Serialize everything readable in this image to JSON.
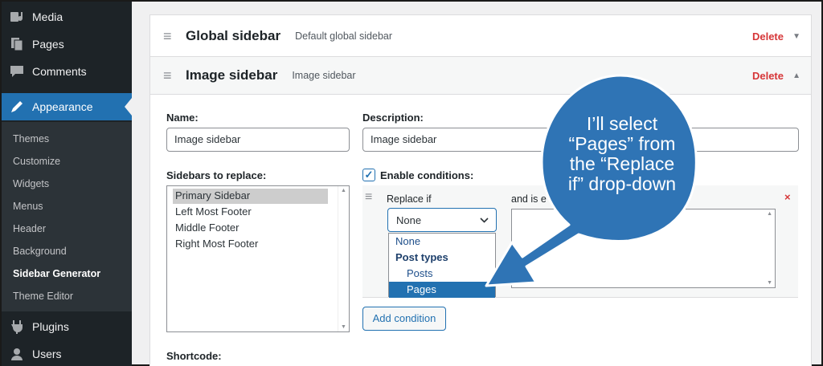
{
  "sidebar": {
    "menu": [
      {
        "label": "Media",
        "icon": "media-icon"
      },
      {
        "label": "Pages",
        "icon": "pages-icon"
      },
      {
        "label": "Comments",
        "icon": "comments-icon"
      },
      {
        "label": "Appearance",
        "icon": "appearance-brush-icon"
      },
      {
        "label": "Plugins",
        "icon": "plugins-icon"
      },
      {
        "label": "Users",
        "icon": "users-icon"
      }
    ],
    "submenu": [
      "Themes",
      "Customize",
      "Widgets",
      "Menus",
      "Header",
      "Background",
      "Sidebar Generator",
      "Theme Editor"
    ],
    "accent": "#2271b1"
  },
  "global_panel": {
    "title": "Global sidebar",
    "subtitle": "Default global sidebar",
    "delete_label": "Delete"
  },
  "image_panel": {
    "title": "Image sidebar",
    "subtitle": "Image sidebar",
    "delete_label": "Delete",
    "name_label": "Name:",
    "name_value": "Image sidebar",
    "description_label": "Description:",
    "description_value": "Image sidebar",
    "replace_label": "Sidebars to replace:",
    "replace_options": [
      "Primary Sidebar",
      "Left Most Footer",
      "Middle Footer",
      "Right Most Footer"
    ],
    "conditions_label": "Enable conditions:",
    "replace_if_label": "Replace if",
    "and_is_label": "and is e",
    "select_value": "None",
    "dropdown_options": [
      "None",
      "Post types",
      "Posts",
      "Pages"
    ],
    "add_condition_label": "Add condition",
    "shortcode_label": "Shortcode:",
    "delete_color": "#d63638"
  },
  "callout": {
    "lines": [
      "I’ll select",
      "“Pages” from",
      "the “Replace",
      "if” drop-down"
    ],
    "color": "#2f74b5"
  }
}
